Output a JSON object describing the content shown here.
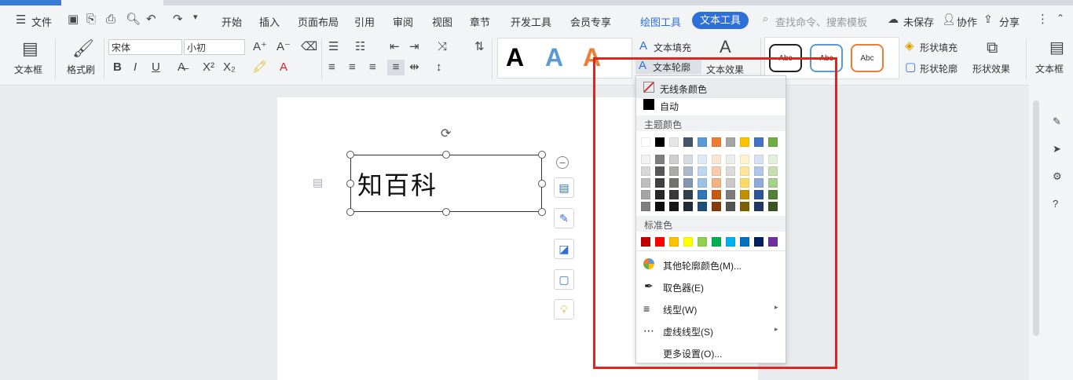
{
  "menu": {
    "file": "文件",
    "tabs": [
      "开始",
      "插入",
      "页面布局",
      "引用",
      "审阅",
      "视图",
      "章节",
      "开发工具",
      "会员专享"
    ],
    "drawing_tools": "绘图工具",
    "text_tools": "文本工具",
    "search_placeholder": "查找命令、搜索模板",
    "unsaved": "未保存",
    "collaborate": "协作",
    "share": "分享"
  },
  "ribbon": {
    "textbox": "文本框",
    "format_painter": "格式刷",
    "font_name": "宋体",
    "font_size": "小初",
    "text_fill": "文本填充",
    "text_outline": "文本轮廓",
    "text_effect": "文本效果",
    "shape_fill": "形状填充",
    "shape_outline": "形状轮廓",
    "shape_effect": "形状效果",
    "textbox_right": "文本框",
    "abc": "Abc",
    "wordart_letter": "A"
  },
  "document": {
    "textbox_text": "知百科"
  },
  "dropdown": {
    "no_line_color": "无线条颜色",
    "auto": "自动",
    "theme_colors": "主题颜色",
    "standard_colors": "标准色",
    "other_colors": "其他轮廓颜色(M)...",
    "eyedropper": "取色器(E)",
    "line_style": "线型(W)",
    "dash_style": "虚线线型(S)",
    "more_settings": "更多设置(O)..."
  },
  "colors": {
    "accent": "#2f6fd8",
    "highlight_rect": "#e0251e",
    "theme_top": [
      "#ffffff",
      "#000000",
      "#e7e6e6",
      "#44546a",
      "#5b9bd5",
      "#ed7d31",
      "#a5a5a5",
      "#ffc000",
      "#4472c4",
      "#70ad47"
    ],
    "theme_shades": [
      [
        "#f2f2f2",
        "#7f7f7f",
        "#d0cece",
        "#d6dce4",
        "#deebf6",
        "#fbe5d5",
        "#ededed",
        "#fff2cc",
        "#d9e2f3",
        "#e2efd9"
      ],
      [
        "#d8d8d8",
        "#595959",
        "#aeaaaa",
        "#adb9ca",
        "#bdd7ee",
        "#f7cbac",
        "#dbdbdb",
        "#fee599",
        "#b4c6e7",
        "#c5e0b3"
      ],
      [
        "#bfbfbf",
        "#3f3f3f",
        "#757070",
        "#8496b0",
        "#9cc3e5",
        "#f4b183",
        "#c9c9c9",
        "#ffd965",
        "#8eaadb",
        "#a8d08d"
      ],
      [
        "#a5a5a5",
        "#262626",
        "#3a3838",
        "#323f4f",
        "#2e75b5",
        "#c55a11",
        "#7b7b7b",
        "#bf9000",
        "#2f5496",
        "#538135"
      ],
      [
        "#7f7f7f",
        "#0c0c0c",
        "#171616",
        "#222a35",
        "#1e4e79",
        "#843c0b",
        "#525252",
        "#7f6000",
        "#1f3864",
        "#375623"
      ]
    ],
    "standard": [
      "#c00000",
      "#ff0000",
      "#ffc000",
      "#ffff00",
      "#92d050",
      "#00b050",
      "#00b0f0",
      "#0070c0",
      "#002060",
      "#7030a0"
    ]
  }
}
